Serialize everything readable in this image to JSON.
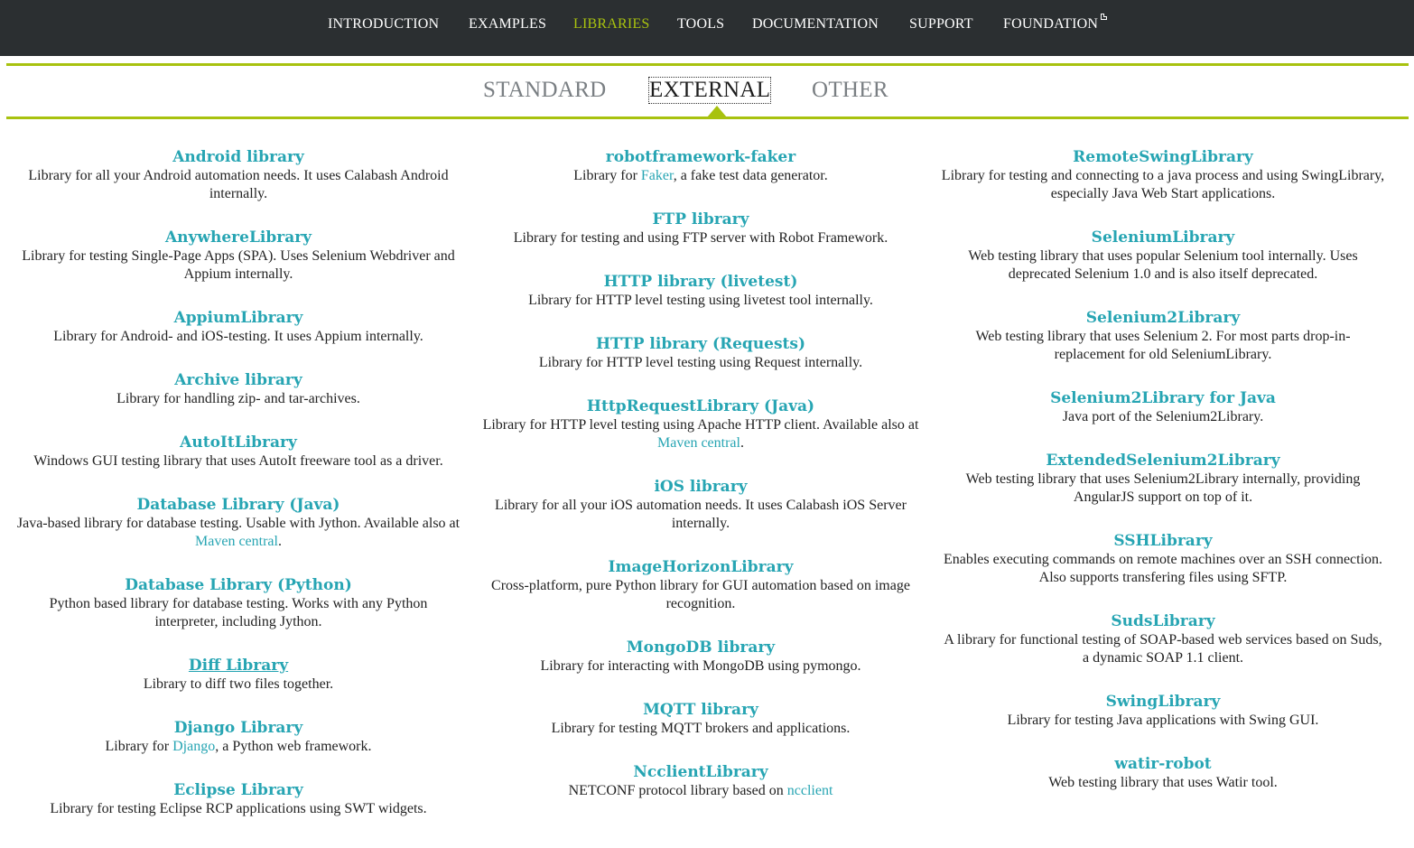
{
  "topnav": {
    "items": [
      {
        "label": "INTRODUCTION"
      },
      {
        "label": "EXAMPLES"
      },
      {
        "label": "LIBRARIES"
      },
      {
        "label": "TOOLS"
      },
      {
        "label": "DOCUMENTATION"
      },
      {
        "label": "SUPPORT"
      },
      {
        "label": "FOUNDATION"
      }
    ],
    "active": "LIBRARIES"
  },
  "subnav": {
    "tabs": [
      {
        "label": "STANDARD"
      },
      {
        "label": "EXTERNAL"
      },
      {
        "label": "OTHER"
      }
    ],
    "active": "EXTERNAL"
  },
  "colors": {
    "accent": "#a8c20f",
    "link": "#27a5b3",
    "nav_bg": "#2b2f31"
  },
  "libraries": {
    "col1": [
      {
        "title": "Android library",
        "desc": "Library for all your Android automation needs. It uses Calabash Android internally."
      },
      {
        "title": "AnywhereLibrary",
        "desc": "Library for testing Single-Page Apps (SPA). Uses Selenium Webdriver and Appium internally."
      },
      {
        "title": "AppiumLibrary",
        "desc": "Library for Android- and iOS-testing. It uses Appium internally."
      },
      {
        "title": "Archive library",
        "desc": "Library for handling zip- and tar-archives."
      },
      {
        "title": "AutoItLibrary",
        "desc": "Windows GUI testing library that uses AutoIt freeware tool as a driver."
      },
      {
        "title": "Database Library (Java)",
        "desc_pre": "Java-based library for database testing. Usable with Jython. Available also at ",
        "desc_link": "Maven central",
        "desc_post": "."
      },
      {
        "title": "Database Library (Python)",
        "desc": "Python based library for database testing. Works with any Python interpreter, including Jython."
      },
      {
        "title": "Diff Library",
        "desc": "Library to diff two files together."
      },
      {
        "title": "Django Library",
        "desc_pre": "Library for ",
        "desc_link": "Django",
        "desc_post": ", a Python web framework."
      },
      {
        "title": "Eclipse Library",
        "desc": "Library for testing Eclipse RCP applications using SWT widgets."
      }
    ],
    "col2": [
      {
        "title": "robotframework-faker",
        "desc_pre": "Library for ",
        "desc_link": "Faker",
        "desc_post": ", a fake test data generator."
      },
      {
        "title": "FTP library",
        "desc": "Library for testing and using FTP server with Robot Framework."
      },
      {
        "title": "HTTP library (livetest)",
        "desc": "Library for HTTP level testing using livetest tool internally."
      },
      {
        "title": "HTTP library (Requests)",
        "desc": "Library for HTTP level testing using Request internally."
      },
      {
        "title": "HttpRequestLibrary (Java)",
        "desc_pre": "Library for HTTP level testing using Apache HTTP client. Available also at ",
        "desc_link": "Maven central",
        "desc_post": "."
      },
      {
        "title": "iOS library",
        "desc": "Library for all your iOS automation needs. It uses Calabash iOS Server internally."
      },
      {
        "title": "ImageHorizonLibrary",
        "desc": "Cross-platform, pure Python library for GUI automation based on image recognition."
      },
      {
        "title": "MongoDB library",
        "desc": "Library for interacting with MongoDB using pymongo."
      },
      {
        "title": "MQTT library",
        "desc": "Library for testing MQTT brokers and applications."
      },
      {
        "title": "NcclientLibrary",
        "desc_pre": "NETCONF protocol library based on ",
        "desc_link": "ncclient",
        "desc_post": ""
      }
    ],
    "col3": [
      {
        "title": "RemoteSwingLibrary",
        "desc": "Library for testing and connecting to a java process and using SwingLibrary, especially Java Web Start applications."
      },
      {
        "title": "SeleniumLibrary",
        "desc": "Web testing library that uses popular Selenium tool internally. Uses deprecated Selenium 1.0 and is also itself deprecated."
      },
      {
        "title": "Selenium2Library",
        "desc": "Web testing library that uses Selenium 2. For most parts drop-in-replacement for old SeleniumLibrary."
      },
      {
        "title": "Selenium2Library for Java",
        "desc": "Java port of the Selenium2Library."
      },
      {
        "title": "ExtendedSelenium2Library",
        "desc": "Web testing library that uses Selenium2Library internally, providing AngularJS support on top of it."
      },
      {
        "title": "SSHLibrary",
        "desc": "Enables executing commands on remote machines over an SSH connection. Also supports transfering files using SFTP."
      },
      {
        "title": "SudsLibrary",
        "desc": "A library for functional testing of SOAP-based web services based on Suds, a dynamic SOAP 1.1 client."
      },
      {
        "title": "SwingLibrary",
        "desc": "Library for testing Java applications with Swing GUI."
      },
      {
        "title": "watir-robot",
        "desc": "Web testing library that uses Watir tool."
      }
    ]
  }
}
